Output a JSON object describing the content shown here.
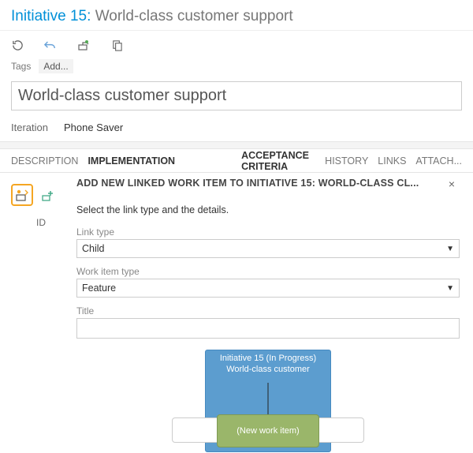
{
  "header": {
    "type_label": "Initiative 15:",
    "title": "World-class customer support"
  },
  "toolbar": {
    "icon1": "refresh",
    "icon2": "undo",
    "icon3": "link-work",
    "icon4": "copy"
  },
  "tags": {
    "label": "Tags",
    "add_label": "Add..."
  },
  "titleField": {
    "value": "World-class customer support"
  },
  "iteration": {
    "label": "Iteration",
    "value": "Phone Saver"
  },
  "tabs": {
    "description": "DESCRIPTION",
    "implementation": "IMPLEMENTATION",
    "acceptance": "ACCEPTANCE CRITERIA",
    "history": "HISTORY",
    "links": "LINKS",
    "attach": "ATTACH..."
  },
  "impl": {
    "id_label": "ID"
  },
  "dialog": {
    "title": "ADD NEW LINKED WORK ITEM TO INITIATIVE 15: WORLD-CLASS CL...",
    "close": "×",
    "instruction": "Select the link type and the details.",
    "link_type_label": "Link type",
    "link_type_value": "Child",
    "work_item_type_label": "Work item type",
    "work_item_type_value": "Feature",
    "title_label": "Title",
    "title_value": "",
    "diagram": {
      "parent_line1": "Initiative 15 (In Progress)",
      "parent_line2": "World-class customer",
      "new_item": "(New work item)"
    }
  }
}
